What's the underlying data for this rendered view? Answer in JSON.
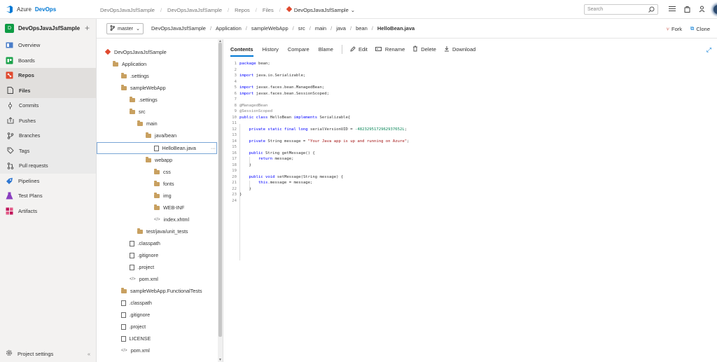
{
  "header": {
    "brand_prefix": "Azure",
    "brand_name": "DevOps",
    "breadcrumbs": [
      "DevOpsJavaJsfSample",
      "DevOpsJavaJsfSample",
      "Repos",
      "Files"
    ],
    "repo_name": "DevOpsJavaJsfSample",
    "search_placeholder": "Search"
  },
  "sidebar": {
    "project": "DevOpsJavaJsfSample",
    "project_initial": "D",
    "items": [
      {
        "label": "Overview"
      },
      {
        "label": "Boards"
      },
      {
        "label": "Repos"
      },
      {
        "label": "Files"
      },
      {
        "label": "Commits"
      },
      {
        "label": "Pushes"
      },
      {
        "label": "Branches"
      },
      {
        "label": "Tags"
      },
      {
        "label": "Pull requests"
      },
      {
        "label": "Pipelines"
      },
      {
        "label": "Test Plans"
      },
      {
        "label": "Artifacts"
      }
    ],
    "settings_label": "Project settings"
  },
  "pathbar": {
    "branch": "master",
    "segments": [
      "DevOpsJavaJsfSample",
      "Application",
      "sampleWebApp",
      "src",
      "main",
      "java",
      "bean"
    ],
    "current": "HelloBean.java",
    "fork_label": "Fork",
    "clone_label": "Clone"
  },
  "tree": [
    {
      "label": "DevOpsJavaJsfSample"
    },
    {
      "label": "Application"
    },
    {
      "label": ".settings"
    },
    {
      "label": "sampleWebApp"
    },
    {
      "label": ".settings"
    },
    {
      "label": "src"
    },
    {
      "label": "main"
    },
    {
      "label": "java/bean"
    },
    {
      "label": "HelloBean.java"
    },
    {
      "label": "webapp"
    },
    {
      "label": "css"
    },
    {
      "label": "fonts"
    },
    {
      "label": "img"
    },
    {
      "label": "WEB-INF"
    },
    {
      "label": "index.xhtml"
    },
    {
      "label": "test/java/unit_tests"
    },
    {
      "label": ".classpath"
    },
    {
      "label": ".gitignore"
    },
    {
      "label": ".project"
    },
    {
      "label": "pom.xml"
    },
    {
      "label": "sampleWebApp.FunctionalTests"
    },
    {
      "label": ".classpath"
    },
    {
      "label": ".gitignore"
    },
    {
      "label": ".project"
    },
    {
      "label": "LICENSE"
    },
    {
      "label": "pom.xml"
    }
  ],
  "tree_more": "···",
  "tabs": {
    "contents": "Contents",
    "history": "History",
    "compare": "Compare",
    "blame": "Blame",
    "edit": "Edit",
    "rename": "Rename",
    "delete": "Delete",
    "download": "Download"
  },
  "code": {
    "l1_kw": "package",
    "l1_rest": " bean;",
    "l3_kw": "import",
    "l3_rest": " java.io.Serializable;",
    "l5_kw": "import",
    "l5_rest": " javax.faces.bean.ManagedBean;",
    "l6_kw": "import",
    "l6_rest": " javax.faces.bean.SessionScoped;",
    "l8": "@ManagedBean",
    "l9": "@SessionScoped",
    "l10_kw1": "public class",
    "l10_mid": " HelloBean ",
    "l10_kw2": "implements",
    "l10_rest": " Serializable{",
    "l12_kw": "    private static final long",
    "l12_mid": " serialVersionUID = ",
    "l12_num": "-4823295172962937652L",
    "l12_end": ";",
    "l14_kw": "    private",
    "l14_mid": " String message = ",
    "l14_str": "\"Your Java app is up and running on Azure\"",
    "l14_end": ";",
    "l16_kw": "    public",
    "l16_rest": " String getMessage() {",
    "l17_kw": "        return",
    "l17_rest": " message;",
    "l18": "    }",
    "l20_kw": "    public void",
    "l20_rest": " setMessage(String message) {",
    "l21_kw": "        this",
    "l21_rest": ".message = message;",
    "l22": "    }",
    "l23": "}",
    "line_numbers": [
      "1",
      "2",
      "3",
      "4",
      "5",
      "6",
      "7",
      "8",
      "9",
      "10",
      "11",
      "12",
      "13",
      "14",
      "15",
      "16",
      "17",
      "18",
      "19",
      "20",
      "21",
      "22",
      "23",
      "24"
    ]
  }
}
